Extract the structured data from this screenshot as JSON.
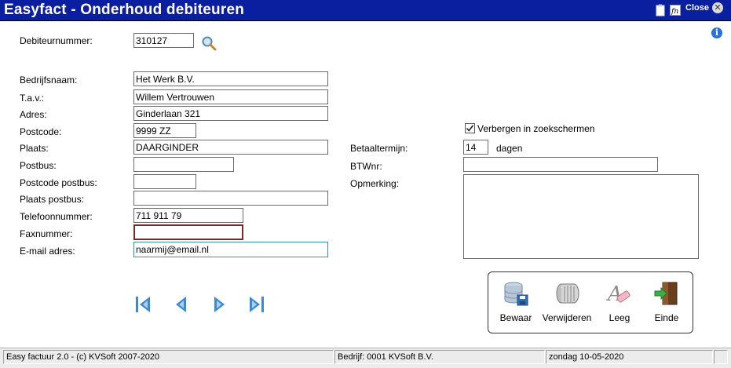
{
  "window": {
    "title": "Easyfact - Onderhoud debiteuren",
    "close_label": "Close"
  },
  "form": {
    "debiteurnummer": {
      "label": "Debiteurnummer:",
      "value": "310127"
    },
    "bedrijfsnaam": {
      "label": "Bedrijfsnaam:",
      "value": "Het Werk B.V."
    },
    "tav": {
      "label": "T.a.v.:",
      "value": "Willem Vertrouwen"
    },
    "adres": {
      "label": "Adres:",
      "value": "Ginderlaan 321"
    },
    "postcode": {
      "label": "Postcode:",
      "value": "9999 ZZ"
    },
    "plaats": {
      "label": "Plaats:",
      "value": "DAARGINDER"
    },
    "postbus": {
      "label": "Postbus:",
      "value": ""
    },
    "postcode_postbus": {
      "label": "Postcode postbus:",
      "value": ""
    },
    "plaats_postbus": {
      "label": "Plaats postbus:",
      "value": ""
    },
    "telefoonnummer": {
      "label": "Telefoonnummer:",
      "value": "711 911 79"
    },
    "faxnummer": {
      "label": "Faxnummer:",
      "value": ""
    },
    "email": {
      "label": "E-mail adres:",
      "value": "naarmij@email.nl"
    },
    "verbergen": {
      "label": "Verbergen in zoekschermen",
      "checked": true
    },
    "betaaltermijn": {
      "label": "Betaaltermijn:",
      "value": "14",
      "unit": "dagen"
    },
    "btwnr": {
      "label": "BTWnr:",
      "value": ""
    },
    "opmerking": {
      "label": "Opmerking:",
      "value": ""
    }
  },
  "toolbar": {
    "save": "Bewaar",
    "delete": "Verwijderen",
    "clear": "Leeg",
    "exit": "Einde"
  },
  "navigation": {
    "first": "first-record-icon",
    "previous": "previous-record-icon",
    "next": "next-record-icon",
    "last": "last-record-icon"
  },
  "statusbar": {
    "app": "Easy factuur 2.0 - (c) KVSoft 2007-2020",
    "company": "Bedrijf: 0001 KVSoft B.V.",
    "date": "zondag 10-05-2020"
  },
  "colors": {
    "titlebar": "#0a1ea0",
    "nav_blue": "#3a8ad6",
    "fax_border": "#7a2a2a",
    "email_border": "#3b8ea8"
  }
}
